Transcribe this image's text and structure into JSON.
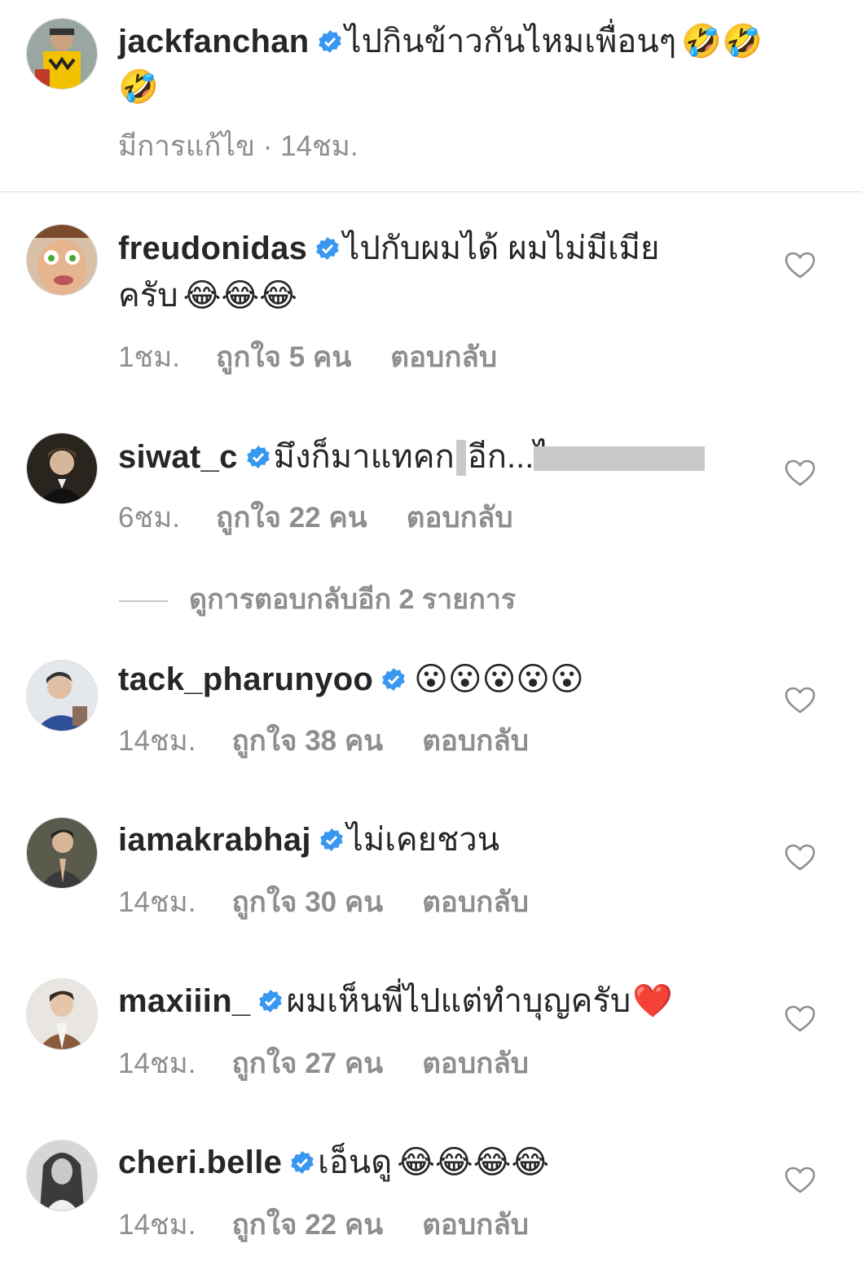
{
  "post": {
    "username": "jackfanchan",
    "caption": "ไปกินข้าวกันไหมเพื่อนๆ",
    "caption_emojis": "🤣🤣",
    "caption_emoji_line2": "🤣",
    "edited_label": "มีการแก้ไข",
    "time": "14ชม.",
    "meta_sep": " · "
  },
  "comments": [
    {
      "username": "freudonidas",
      "text": "ไปกับผมได้ ผมไม่มีเมีย",
      "text_line2": "ครับ",
      "emojis": "😂😂😂",
      "time": "1ชม.",
      "likes": "ถูกใจ 5 คน",
      "reply": "ตอบกลับ"
    },
    {
      "username": "siwat_c",
      "text_a": "มึงก็มาแทคก",
      "text_b": "อีก...ไ",
      "time": "6ชม.",
      "likes": "ถูกใจ 22 คน",
      "reply": "ตอบกลับ"
    },
    {
      "username": "tack_pharunyoo",
      "emojis": "😮😮😮😮😮",
      "time": "14ชม.",
      "likes": "ถูกใจ 38 คน",
      "reply": "ตอบกลับ"
    },
    {
      "username": "iamakrabhaj",
      "text": "ไม่เคยชวน",
      "time": "14ชม.",
      "likes": "ถูกใจ 30 คน",
      "reply": "ตอบกลับ"
    },
    {
      "username": "maxiiin_",
      "text": "ผมเห็นพี่ไปแต่ทำบุญครับ",
      "emojis": "❤️",
      "time": "14ชม.",
      "likes": "ถูกใจ 27 คน",
      "reply": "ตอบกลับ"
    },
    {
      "username": "cheri.belle",
      "text": "เอ็นดู",
      "emojis": "😂😂😂😂",
      "time": "14ชม.",
      "likes": "ถูกใจ 22 คน",
      "reply": "ตอบกลับ"
    }
  ],
  "view_replies": "ดูการตอบกลับอีก 2 รายการ",
  "icons": {
    "verified": "verified-badge-icon",
    "like": "heart-outline-icon"
  },
  "colors": {
    "verified_blue": "#3897f0",
    "meta_gray": "#8e8e8e",
    "text": "#262626"
  }
}
